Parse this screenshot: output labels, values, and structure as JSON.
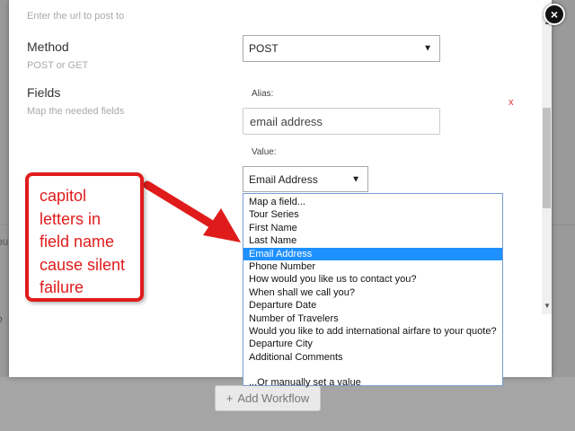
{
  "background": {
    "edge_text_1": "ou",
    "edge_text_2": "o",
    "add_workflow_label": "Add Workflow"
  },
  "modal": {
    "url_hint": "Enter the url to post to",
    "method": {
      "label": "Method",
      "hint": "POST or GET",
      "selected": "POST"
    },
    "fields": {
      "label": "Fields",
      "hint": "Map the needed fields",
      "alias_label": "Alias:",
      "alias_value": "email address",
      "remove_label": "x",
      "value_label": "Value:",
      "value_selected": "Email Address"
    },
    "dropdown_options": [
      "Map a field...",
      "Tour Series",
      "First Name",
      "Last Name",
      "Email Address",
      "Phone Number",
      "How would you like us to contact you?",
      "When shall we call you?",
      "Departure Date",
      "Number of Travelers",
      "Would you like to add international airfare to your quote?",
      "Departure City",
      "Additional Comments",
      "",
      "...Or manually set a value"
    ],
    "selected_option_index": 4
  },
  "annotation": {
    "text": "capitol letters in field name cause silent failure",
    "color": "#e01b1b"
  },
  "close_icon": "×"
}
